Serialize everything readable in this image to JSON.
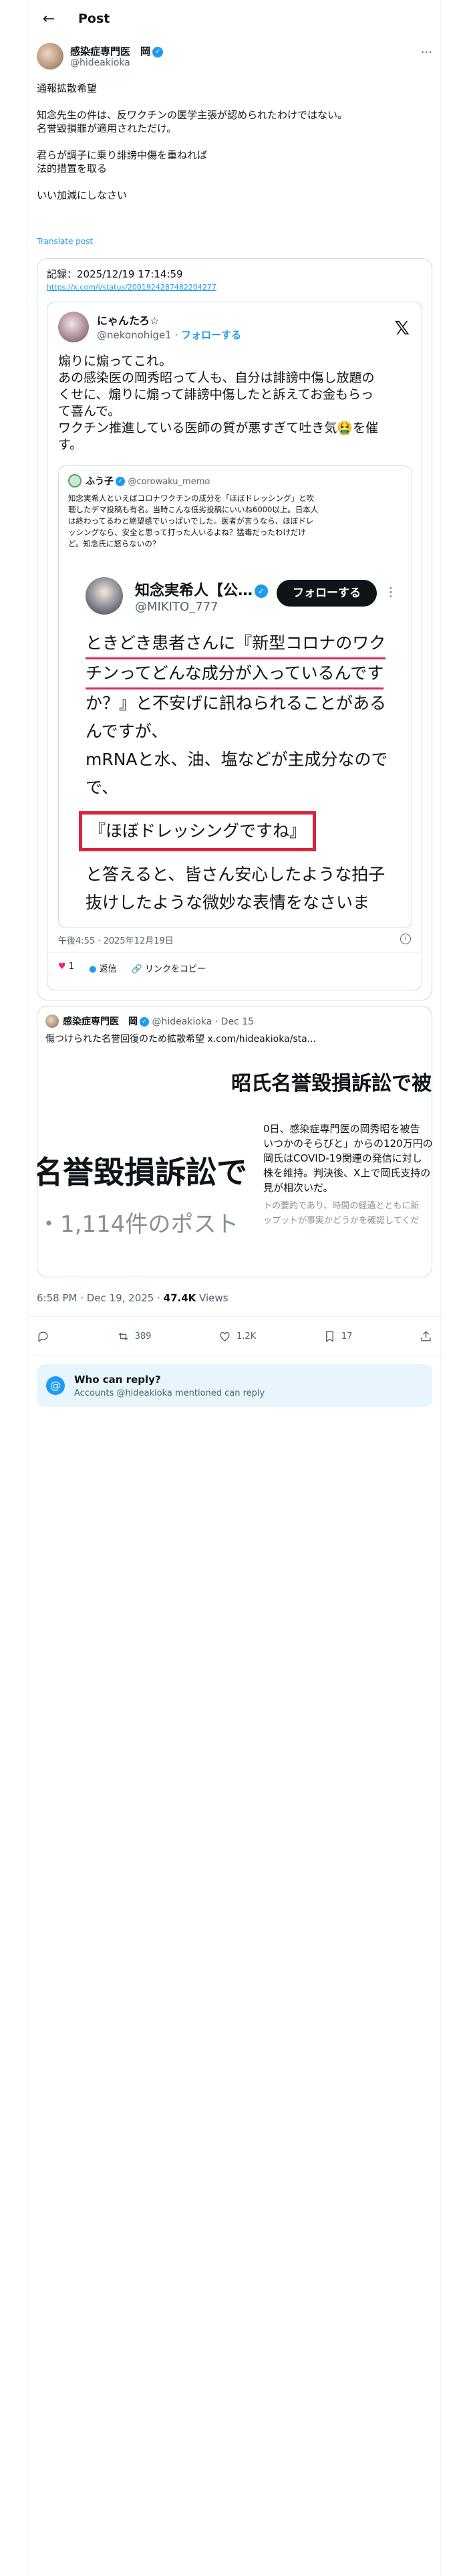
{
  "header": {
    "title": "Post"
  },
  "author": {
    "name": "感染症専門医　岡",
    "handle": "@hideakioka"
  },
  "post": {
    "lines": [
      "通報拡散希望",
      "知念先生の件は、反ワクチンの医学主張が認められたわけではない。",
      "名誉毀損罪が適用されただけ。",
      "君らが調子に乗り誹謗中傷を重ねれば",
      "法的措置を取る",
      "いい加減にしなさい"
    ],
    "translate": "Translate post"
  },
  "record_card": {
    "label": "記録：2025/12/19 17:14:59",
    "url": "https://x.com/i/status/2001924287482204277",
    "tweet": {
      "name": "にゃんたろ☆",
      "handle": "@nekonohige1",
      "follow": "フォローする",
      "text": [
        "煽りに煽ってこれ。",
        "あの感染医の岡秀昭って人も、自分は誹謗中傷し放題の",
        "くせに、煽りに煽って誹謗中傷したと訴えてお金もらっ",
        "て喜んで。",
        "ワクチン推進している医師の質が悪すぎて吐き気🤮を催",
        "す。"
      ],
      "quote": {
        "name": "ふう子",
        "handle": "@corowaku_memo",
        "text": [
          "知念実希人といえばコロナワクチンの成分を「ほぼドレッシング」と吹",
          "聴したデマ投稿も有名。当時こんな低劣投稿にいいね6000以上。日本人",
          "は終わってるわと絶望感でいっぱいでした。医者が言うなら、ほぼドレ",
          "ッシングなら、安全と思って打った人いるよね？猛毒だったわけだけ",
          "ど。知念氏に怒らないの？"
        ],
        "embed": {
          "name": "知念実希人【公…",
          "handle": "@MIKITO_777",
          "follow": "フォローする",
          "lines": [
            "ときどき患者さんに『新型コロナのワク",
            "チンってどんな成分が入っているんです",
            "か？』と不安げに訊ねられることがある",
            "んですが、",
            "mRNAと水、油、塩などが主成分なので",
            "で、",
            "『ほぼドレッシングですね』",
            "と答えると、皆さん安心したような拍子",
            "抜けしたような微妙な表情をなさいま"
          ]
        }
      },
      "time": "午後4:55 · 2025年12月19日",
      "likes": "1",
      "reply": "返信",
      "copy": "リンクをコピー"
    }
  },
  "link_card": {
    "title": "傷つけられた名誉回復のため拡散希望 x.com/hideakioka/sta...",
    "image_heading": "昭氏名誉毀損訴訟で被告",
    "image_big": "名誉毀損訴訟で",
    "image_count": "・1,114件のポスト",
    "image_lines": [
      "0日、感染症専門医の岡秀昭を被告",
      "いつかのそらびと」からの120万円の",
      "岡氏はCOVID-19関連の発信に対し",
      "株を維持。判決後、X上で岡氏支持の",
      "見が相次いだ。",
      "トの要約であり、時間の経過とともに新",
      "ップットが事実かどうかを確認してくだ"
    ]
  },
  "meta": {
    "time": "6:58 PM · Dec 19, 2025 · ",
    "views": "47.4K",
    "views_label": " Views"
  },
  "actions": {
    "reposts": "389",
    "likes": "1.2K",
    "bookmarks": "17"
  },
  "reply_notice": {
    "title": "Who can reply?",
    "text": "Accounts @hideakioka mentioned can reply"
  },
  "quoted_post": {
    "name": "感染症専門医　岡",
    "handle": "@hideakioka",
    "date": "· Dec 15"
  }
}
